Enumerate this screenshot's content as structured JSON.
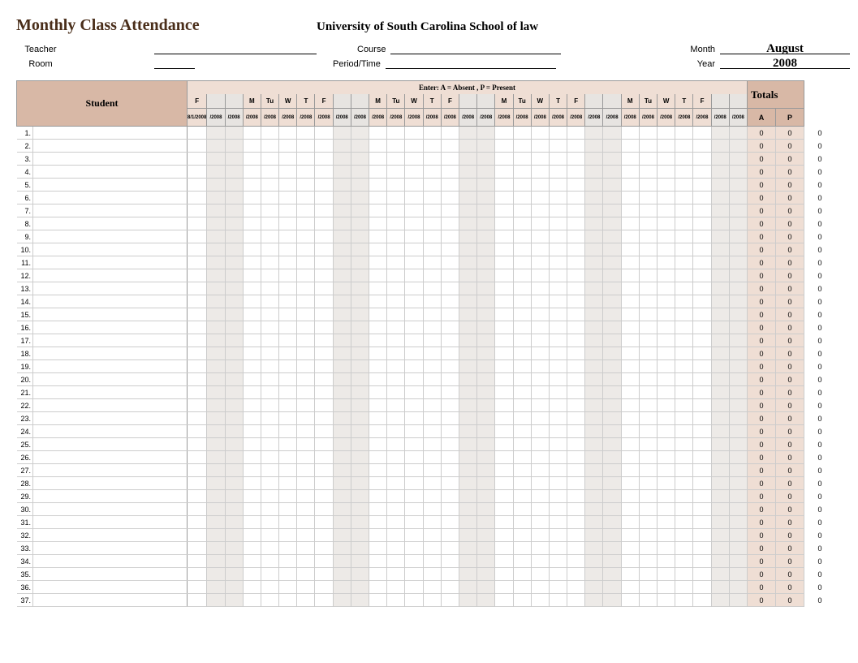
{
  "title": "Monthly Class Attendance",
  "subtitle": "University of South Carolina School of law",
  "labels": {
    "teacher": "Teacher",
    "course": "Course",
    "month": "Month",
    "room": "Room",
    "period": "Period/Time",
    "year": "Year",
    "student": "Student",
    "legend": "Enter:  A = Absent ,  P = Present",
    "totals": "Totals",
    "a": "A",
    "p": "P"
  },
  "values": {
    "teacher": "",
    "course": "",
    "month": "August",
    "room": "",
    "period": "",
    "year": "2008"
  },
  "days": [
    {
      "dow": "F",
      "date": "8/1/2008",
      "wk": false
    },
    {
      "dow": "",
      "date": "/2008",
      "wk": true
    },
    {
      "dow": "",
      "date": "/2008",
      "wk": true
    },
    {
      "dow": "M",
      "date": "/2008",
      "wk": false
    },
    {
      "dow": "Tu",
      "date": "/2008",
      "wk": false
    },
    {
      "dow": "W",
      "date": "/2008",
      "wk": false
    },
    {
      "dow": "T",
      "date": "/2008",
      "wk": false
    },
    {
      "dow": "F",
      "date": "/2008",
      "wk": false
    },
    {
      "dow": "",
      "date": "/2008",
      "wk": true
    },
    {
      "dow": "",
      "date": "/2008",
      "wk": true
    },
    {
      "dow": "M",
      "date": "/2008",
      "wk": false
    },
    {
      "dow": "Tu",
      "date": "/2008",
      "wk": false
    },
    {
      "dow": "W",
      "date": "/2008",
      "wk": false
    },
    {
      "dow": "T",
      "date": "/2008",
      "wk": false
    },
    {
      "dow": "F",
      "date": "/2008",
      "wk": false
    },
    {
      "dow": "",
      "date": "/2008",
      "wk": true
    },
    {
      "dow": "",
      "date": "/2008",
      "wk": true
    },
    {
      "dow": "M",
      "date": "/2008",
      "wk": false
    },
    {
      "dow": "Tu",
      "date": "/2008",
      "wk": false
    },
    {
      "dow": "W",
      "date": "/2008",
      "wk": false
    },
    {
      "dow": "T",
      "date": "/2008",
      "wk": false
    },
    {
      "dow": "F",
      "date": "/2008",
      "wk": false
    },
    {
      "dow": "",
      "date": "/2008",
      "wk": true
    },
    {
      "dow": "",
      "date": "/2008",
      "wk": true
    },
    {
      "dow": "M",
      "date": "/2008",
      "wk": false
    },
    {
      "dow": "Tu",
      "date": "/2008",
      "wk": false
    },
    {
      "dow": "W",
      "date": "/2008",
      "wk": false
    },
    {
      "dow": "T",
      "date": "/2008",
      "wk": false
    },
    {
      "dow": "F",
      "date": "/2008",
      "wk": false
    },
    {
      "dow": "",
      "date": "/2008",
      "wk": true
    },
    {
      "dow": "",
      "date": "/2008",
      "wk": true
    }
  ],
  "rows": 37,
  "tot_a": "0",
  "tot_p": "0",
  "ext": "0"
}
